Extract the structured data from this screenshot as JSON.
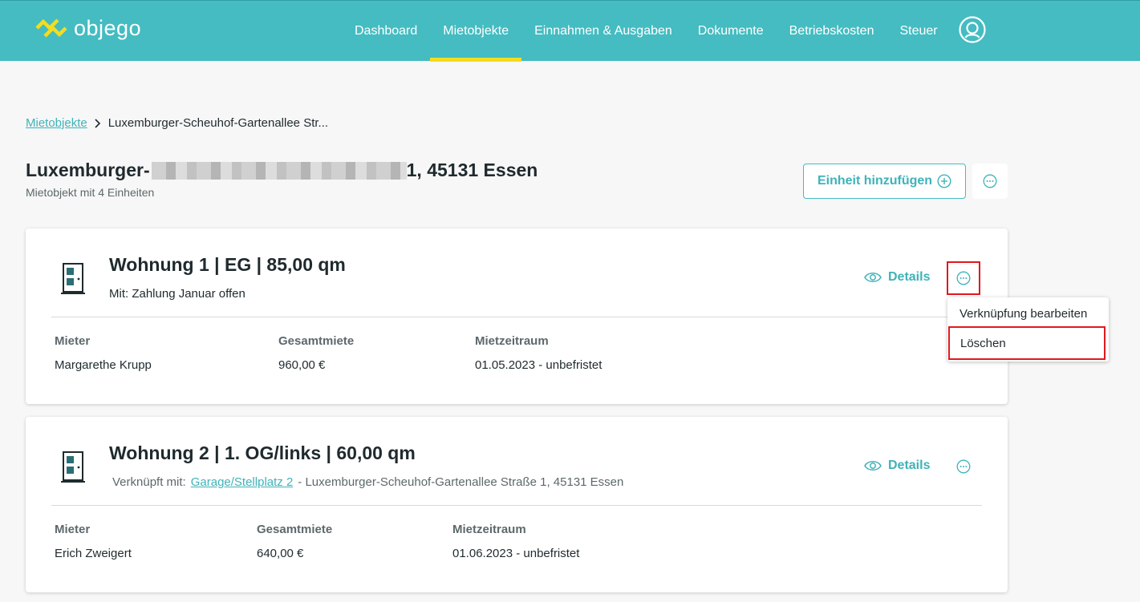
{
  "header": {
    "logo_text": "objego",
    "brand_color": "#44bcc1",
    "accent_color": "#f3dd1f",
    "nav": [
      {
        "label": "Dashboard",
        "active": false
      },
      {
        "label": "Mietobjekte",
        "active": true
      },
      {
        "label": "Einnahmen & Ausgaben",
        "active": false
      },
      {
        "label": "Dokumente",
        "active": false
      },
      {
        "label": "Betriebskosten",
        "active": false
      },
      {
        "label": "Steuer",
        "active": false
      }
    ],
    "user_icon": "user-circle-icon"
  },
  "breadcrumb": {
    "link": "Mietobjekte",
    "current": "Luxemburger-Scheuhof-Gartenallee Str..."
  },
  "property": {
    "title_start": "Luxemburger-",
    "title_end": "1, 45131 Essen",
    "subtitle": "Mietobjekt mit 4 Einheiten",
    "add_unit_label": "Einheit hinzufügen",
    "add_unit_icon": "plus-circle-icon",
    "more_icon": "more-horizontal-icon"
  },
  "units": [
    {
      "title": "Wohnung 1 | EG | 85,00 qm",
      "subtitle": "Mit: Zahlung Januar offen",
      "details_label": "Details",
      "columns": {
        "tenant_label": "Mieter",
        "tenant_value": "Margarethe Krupp",
        "rent_label": "Gesamtmiete",
        "rent_value": "960,00 €",
        "period_label": "Mietzeitraum",
        "period_value": "01.05.2023 - unbefristet"
      }
    },
    {
      "title": "Wohnung 2 | 1. OG/links | 60,00 qm",
      "linked_prefix": "Verknüpft mit:",
      "linked_link": "Garage/Stellplatz 2",
      "linked_suffix": "- Luxemburger-Scheuhof-Gartenallee Straße 1, 45131 Essen",
      "details_label": "Details",
      "columns": {
        "tenant_label": "Mieter",
        "tenant_value": "Erich Zweigert",
        "rent_label": "Gesamtmiete",
        "rent_value": "640,00 €",
        "period_label": "Mietzeitraum",
        "period_value": "01.06.2023 - unbefristet"
      }
    }
  ],
  "dropdown": {
    "items": [
      "Verknüpfung bearbeiten",
      "Löschen"
    ]
  }
}
